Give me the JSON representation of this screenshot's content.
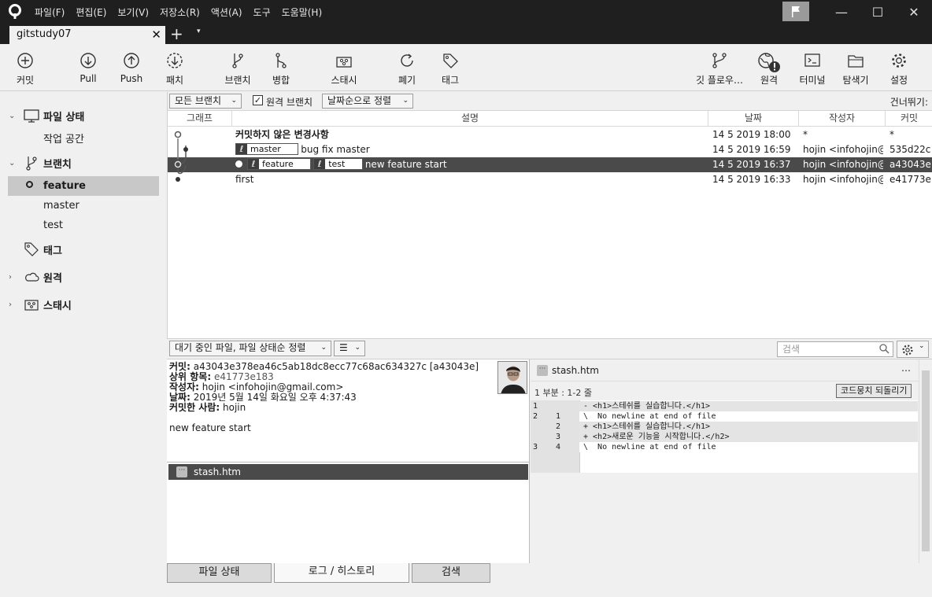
{
  "menu": [
    "파일(F)",
    "편집(E)",
    "보기(V)",
    "저장소(R)",
    "액션(A)",
    "도구",
    "도움말(H)"
  ],
  "tab": {
    "title": "gitstudy07",
    "close": "✕",
    "add": "+",
    "dropdown": "▾"
  },
  "window": {
    "minimize": "—",
    "maximize": "☐",
    "close": "✕"
  },
  "toolbar": {
    "commit": "커밋",
    "pull": "Pull",
    "push": "Push",
    "patch": "패치",
    "branch": "브랜치",
    "merge": "병합",
    "stash": "스태시",
    "discard": "폐기",
    "tag": "태그",
    "gitflow": "깃 플로우…",
    "remote": "원격",
    "terminal": "터미널",
    "explorer": "탐색기",
    "settings": "설정"
  },
  "sidebar": {
    "file_status": "파일 상태",
    "working_copy": "작업 공간",
    "branches": "브랜치",
    "branch_items": [
      "feature",
      "master",
      "test"
    ],
    "tags": "태그",
    "remotes": "원격",
    "stashes": "스태시"
  },
  "filter": {
    "branches": "모든 브랜치",
    "remote_branches": "원격 브랜치",
    "remote_checked": "✓",
    "sort": "날짜순으로 정렬",
    "skip": "건너뛰기:"
  },
  "columns": {
    "graph": "그래프",
    "desc": "설명",
    "date": "날짜",
    "author": "작성자",
    "commit": "커밋"
  },
  "commits": [
    {
      "desc": "커밋하지 않은 변경사항",
      "date": "14 5 2019 18:00",
      "author": "*",
      "hash": "*"
    },
    {
      "tag": "master",
      "desc": "bug fix master",
      "date": "14 5 2019 16:59",
      "author": "hojin <infohojin@",
      "hash": "535d22c"
    },
    {
      "tags": [
        "feature",
        "test"
      ],
      "desc": "new feature start",
      "date": "14 5 2019 16:37",
      "author": "hojin <infohojin@",
      "hash": "a43043e"
    },
    {
      "desc": "first",
      "date": "14 5 2019 16:33",
      "author": "hojin <infohojin@",
      "hash": "e41773e"
    }
  ],
  "lower": {
    "file_filter": "대기 중인 파일, 파일 상태순 정렬",
    "search_placeholder": "검색"
  },
  "details": {
    "commit_label": "커밋:",
    "commit_value": "a43043e378ea46c5ab18dc8ecc77c68ac634327c [a43043e]",
    "parent_label": "상위 항목:",
    "parent_value": "e41773e183",
    "author_label": "작성자:",
    "author_value": "hojin <infohojin@gmail.com>",
    "date_label": "날짜:",
    "date_value": "2019년 5월 14일 화요일 오후 4:37:43",
    "committer_label": "커밋한 사람:",
    "committer_value": "hojin",
    "message": "new feature start"
  },
  "files": [
    "stash.htm"
  ],
  "diff": {
    "file": "stash.htm",
    "more": "…",
    "hunk": "1 부분 : 1-2 줄",
    "revert": "코드뭉치 되돌리기",
    "lines": [
      {
        "n1": "1",
        "n2": "",
        "code": "- <h1>스테쉬를 실습합니다.</h1>"
      },
      {
        "n1": "2",
        "n2": "1",
        "code": "\\  No newline at end of file"
      },
      {
        "n1": "",
        "n2": "2",
        "code": "+ <h1>스테쉬를 실습합니다.</h1>"
      },
      {
        "n1": "",
        "n2": "3",
        "code": "+ <h2>새로운 기능을 시작합니다.</h2>"
      },
      {
        "n1": "3",
        "n2": "4",
        "code": "\\  No newline at end of file"
      }
    ]
  },
  "bottom_tabs": [
    "파일 상태",
    "로그 / 히스토리",
    "검색"
  ]
}
